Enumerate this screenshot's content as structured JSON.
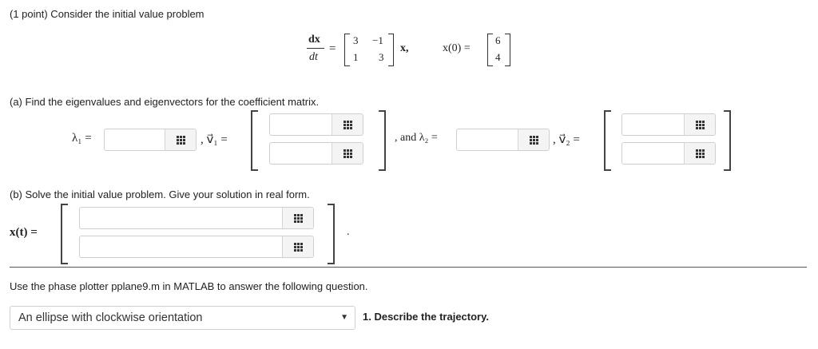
{
  "intro": "(1 point) Consider the initial value problem",
  "ode": {
    "lhs_num": "dx",
    "lhs_den": "dt",
    "eq": "=",
    "matrix": [
      "3",
      "−1",
      "1",
      "3"
    ],
    "vec": "x,",
    "ic_lhs": "x(0) =",
    "ic_vec": [
      "6",
      "4"
    ]
  },
  "part_a": {
    "prompt": "(a) Find the eigenvalues and eigenvectors for the coefficient matrix.",
    "lambda1": "λ₁ =",
    "v1": ", v⃗₁ =",
    "and_lambda2": ", and λ₂ =",
    "v2": ", v⃗₂ ="
  },
  "part_b": {
    "prompt": "(b) Solve the initial value problem. Give your solution in real form.",
    "xt": "x(t) =",
    "period": "."
  },
  "phase": {
    "prompt": "Use the phase plotter pplane9.m in MATLAB to answer the following question.",
    "select_value": "An ellipse with clockwise orientation",
    "question": "1. Describe the trajectory."
  },
  "icons": {
    "button_icon": "grid-icon",
    "select_caret": "caret-down-icon"
  }
}
